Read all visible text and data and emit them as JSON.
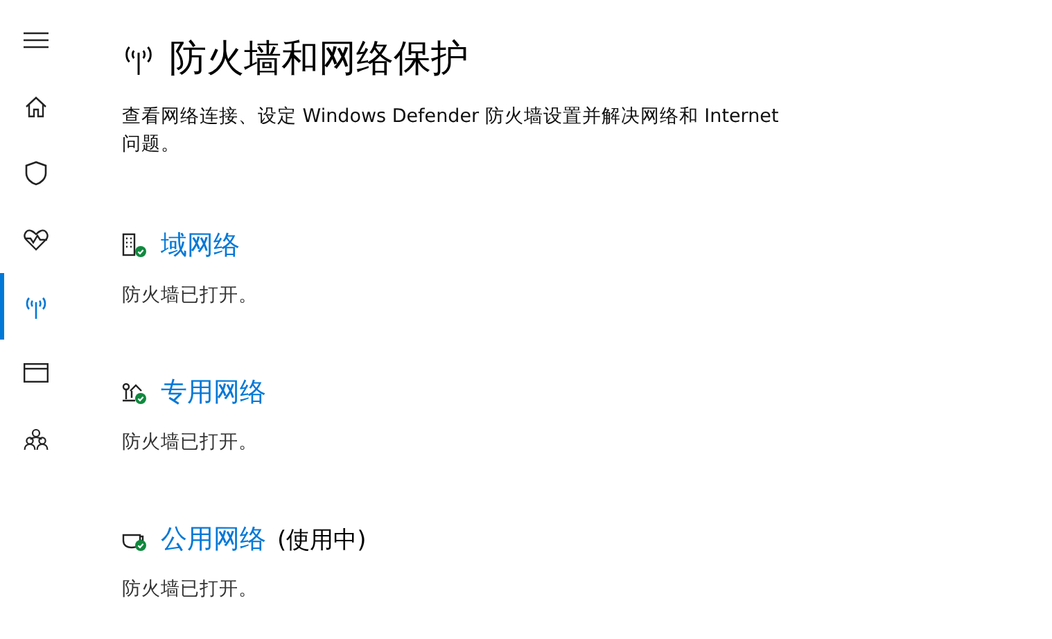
{
  "sidebar": {
    "items": [
      {
        "kind": "menu",
        "selected": false
      },
      {
        "kind": "home",
        "selected": false
      },
      {
        "kind": "shield",
        "selected": false
      },
      {
        "kind": "heart",
        "selected": false
      },
      {
        "kind": "antenna",
        "selected": true
      },
      {
        "kind": "window",
        "selected": false
      },
      {
        "kind": "family",
        "selected": false
      }
    ]
  },
  "page": {
    "title": "防火墙和网络保护",
    "description": "查看网络连接、设定 Windows Defender 防火墙设置并解决网络和 Internet 问题。"
  },
  "networks": [
    {
      "kind": "domain",
      "name": "域网络",
      "status": "防火墙已打开。",
      "protected": true
    },
    {
      "kind": "private",
      "name": "专用网络",
      "status": "防火墙已打开。",
      "protected": true
    },
    {
      "kind": "public",
      "name": "公用网络",
      "tag": "(使用中)",
      "status": "防火墙已打开。",
      "protected": true
    }
  ]
}
